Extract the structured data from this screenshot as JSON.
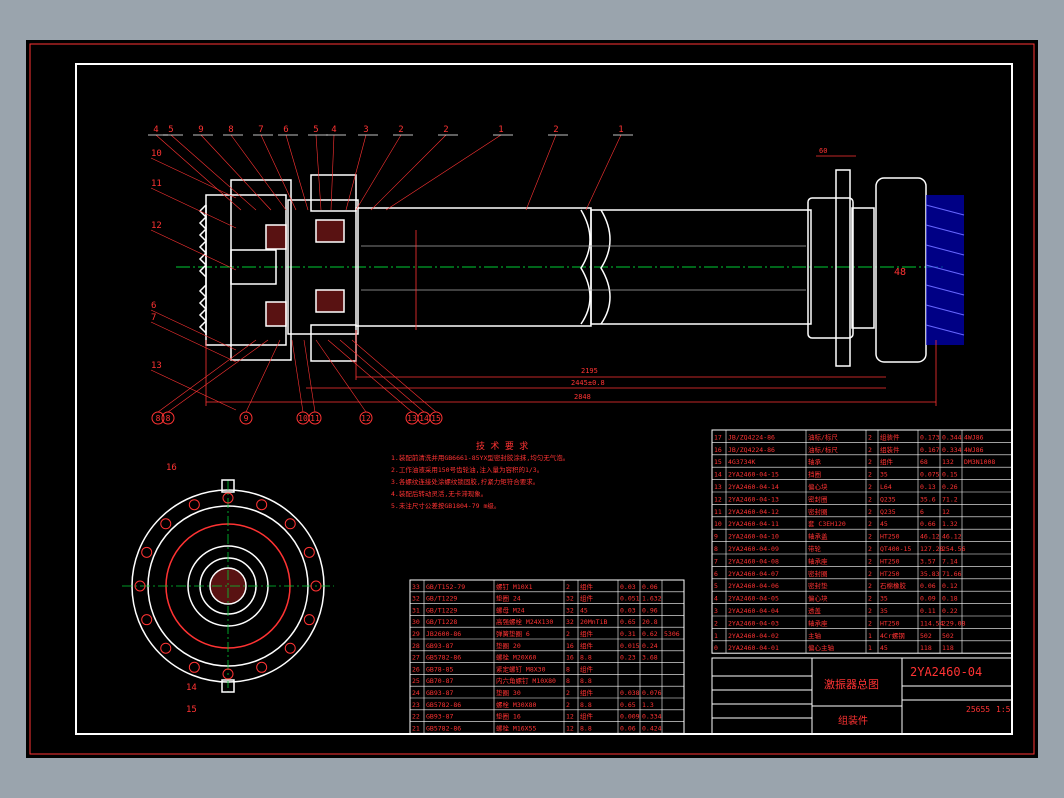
{
  "colors": {
    "frame": "#ffffff",
    "dim": "#ff3333",
    "center": "#00cc33",
    "hatch": "#3333ff",
    "bg": "#000000",
    "page": "#9aa4ad"
  },
  "balloons_top": [
    "4",
    "5",
    "9",
    "8",
    "7",
    "6",
    "5",
    "4",
    "3",
    "2",
    "2",
    "1",
    "2",
    "1"
  ],
  "balloons_bottom": [
    "8",
    "8",
    "9",
    "10",
    "11",
    "12",
    "13",
    "14",
    "15"
  ],
  "balloons_left": [
    "10",
    "11",
    "12",
    "6",
    "7",
    "13"
  ],
  "section_balloons": [
    "16",
    "14",
    "15"
  ],
  "dimensions": {
    "d1": "2195",
    "d2": "2445±0.8",
    "d3": "2848",
    "d4": "60",
    "d5": "48"
  },
  "tech_title": "技 术 要 求",
  "tech_lines": [
    "1.装配前清洗并用GB6661-85YX型密封胶涂抹,均匀无气泡。",
    "2.工作油液采用150号齿轮油,注入量为容积的1/3。",
    "3.各螺纹连接处涂螺纹锁固胶,拧紧力矩符合要求。",
    "4.装配后转动灵活,无卡滞现象。",
    "5.未注尺寸公差按GB1804-79 m级。"
  ],
  "title_block": {
    "name": "激振器总图",
    "drawing_no": "2YA2460-04",
    "scale": "1:5",
    "weight": "25655",
    "kind": "组装件"
  },
  "parts_right": [
    [
      "17",
      "JB/ZQ4224-86",
      "油标/标尺",
      "2",
      "组装件",
      "0.173",
      "0.344",
      "4WJ86"
    ],
    [
      "16",
      "JB/ZQ4224-86",
      "油标/标尺",
      "2",
      "组装件",
      "0.167",
      "0.334",
      "4WJ86"
    ],
    [
      "15",
      "4G3734K",
      "轴承",
      "2",
      "组件",
      "68",
      "132",
      "DM3N1008"
    ],
    [
      "14",
      "2YA2460-04-15",
      "挡圈",
      "2",
      "35",
      "0.075",
      "0.15",
      ""
    ],
    [
      "13",
      "2YA2460-04-14",
      "偏心块",
      "2",
      "L64",
      "0.13",
      "0.26",
      ""
    ],
    [
      "12",
      "2YA2460-04-13",
      "密封圈",
      "2",
      "Q235",
      "35.6",
      "71.2",
      ""
    ],
    [
      "11",
      "2YA2460-04-12",
      "密封圈",
      "2",
      "Q235",
      "6",
      "12",
      ""
    ],
    [
      "10",
      "2YA2460-04-11",
      "套 C3EH120",
      "2",
      "45",
      "0.66",
      "1.32",
      ""
    ],
    [
      "9",
      "2YA2460-04-10",
      "轴承盖",
      "2",
      "HT250",
      "46.12",
      "46.12",
      ""
    ],
    [
      "8",
      "2YA2460-04-09",
      "带轮",
      "2",
      "QT400-15",
      "127.28",
      "254.56",
      ""
    ],
    [
      "7",
      "2YA2460-04-08",
      "轴承座",
      "2",
      "HT250",
      "3.57",
      "7.14",
      ""
    ],
    [
      "6",
      "2YA2460-04-07",
      "密封圈",
      "2",
      "HT250",
      "35.83",
      "71.66",
      ""
    ],
    [
      "5",
      "2YA2460-04-06",
      "密封垫",
      "2",
      "石棉橡胶",
      "0.06",
      "0.12",
      ""
    ],
    [
      "4",
      "2YA2460-04-05",
      "偏心块",
      "2",
      "35",
      "0.09",
      "0.18",
      ""
    ],
    [
      "3",
      "2YA2460-04-04",
      "透盖",
      "2",
      "35",
      "0.11",
      "0.22",
      ""
    ],
    [
      "2",
      "2YA2460-04-03",
      "轴承座",
      "2",
      "HT250",
      "114.54",
      "229.08",
      ""
    ],
    [
      "1",
      "2YA2460-04-02",
      "主轴",
      "1",
      "4Cr螺钢",
      "502",
      "502",
      ""
    ],
    [
      "0",
      "2YA2460-04-01",
      "偏心主轴",
      "1",
      "45",
      "118",
      "118",
      ""
    ]
  ],
  "parts_left": [
    [
      "33",
      "GB/T152-79",
      "螺钉 M10X1",
      "2",
      "组件",
      "0.03",
      "0.06",
      ""
    ],
    [
      "32",
      "GB/T1229",
      "垫圈 24",
      "32",
      "组件",
      "0.051",
      "1.632",
      ""
    ],
    [
      "31",
      "GB/T1229",
      "螺母 M24",
      "32",
      "45",
      "0.03",
      "0.96",
      ""
    ],
    [
      "30",
      "GB/T1228",
      "高强螺栓 M24X130",
      "32",
      "20MnTiB",
      "0.65",
      "20.8",
      ""
    ],
    [
      "29",
      "JB2600-86",
      "弹簧垫圈 6",
      "2",
      "组件",
      "0.31",
      "0.62",
      "5306"
    ],
    [
      "28",
      "GB93-87",
      "垫圈 20",
      "16",
      "组件",
      "0.015",
      "0.24",
      ""
    ],
    [
      "27",
      "GB5782-86",
      "螺栓 M20X60",
      "16",
      "8.8",
      "0.23",
      "3.68",
      ""
    ],
    [
      "26",
      "GB78-85",
      "紧定螺钉 M8X30",
      "8",
      "组件",
      "",
      ""
    ],
    [
      "25",
      "GB70-87",
      "内六角螺钉 M10X80",
      "8",
      "8.8",
      "",
      ""
    ],
    [
      "24",
      "GB93-87",
      "垫圈 30",
      "2",
      "组件",
      "0.038",
      "0.076",
      ""
    ],
    [
      "23",
      "GB5782-86",
      "螺栓 M30X80",
      "2",
      "8.8",
      "0.65",
      "1.3",
      ""
    ],
    [
      "22",
      "GB93-87",
      "垫圈 16",
      "12",
      "组件",
      "0.009",
      "0.334",
      ""
    ],
    [
      "21",
      "GB5782-86",
      "螺栓 M16X55",
      "12",
      "8.8",
      "0.06",
      "0.424",
      ""
    ]
  ]
}
